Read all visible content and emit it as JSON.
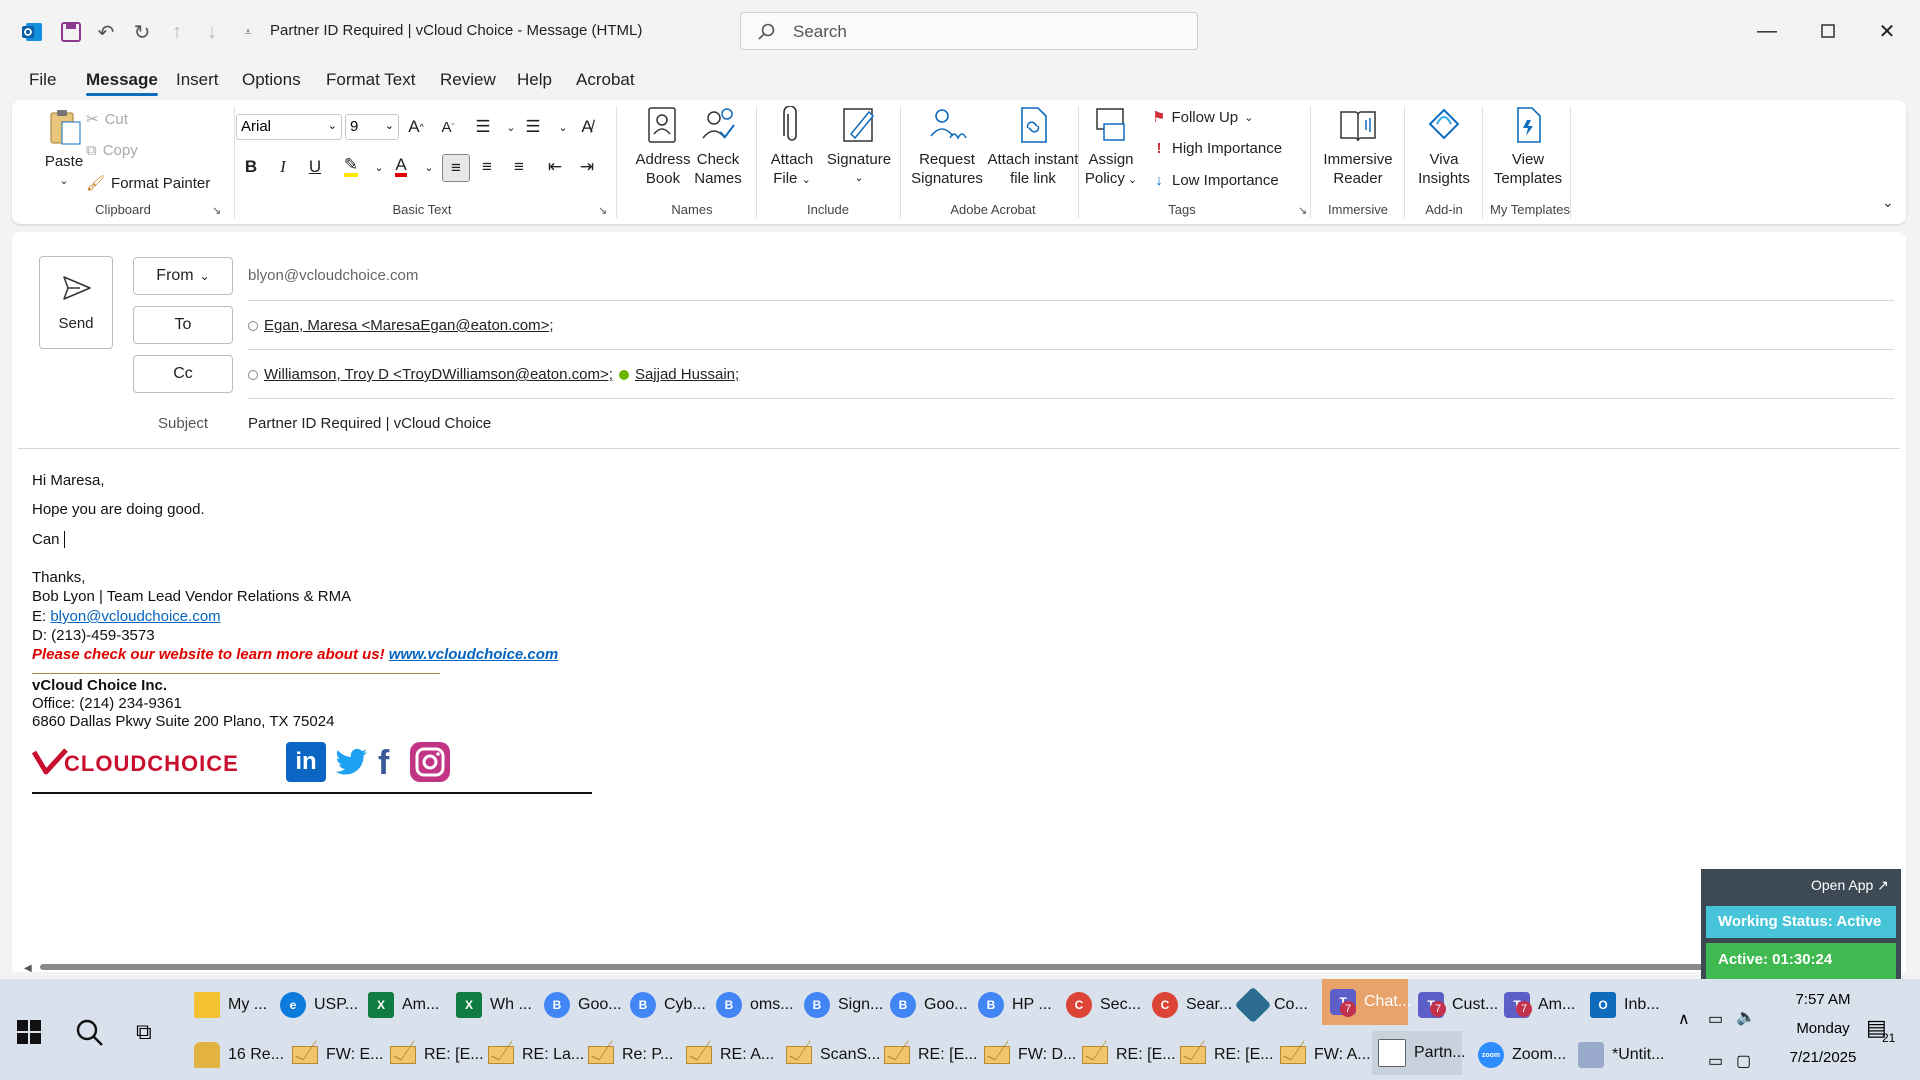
{
  "window": {
    "title": "Partner ID Required | vCloud Choice  -  Message (HTML)",
    "search_placeholder": "Search"
  },
  "menu": {
    "items": [
      "File",
      "Message",
      "Insert",
      "Options",
      "Format Text",
      "Review",
      "Help",
      "Acrobat"
    ],
    "active": "Message"
  },
  "ribbon": {
    "clipboard": {
      "paste": "Paste",
      "cut": "Cut",
      "copy": "Copy",
      "format_painter": "Format Painter",
      "group": "Clipboard"
    },
    "basic_text": {
      "font": "Arial",
      "size": "9",
      "group": "Basic Text"
    },
    "names": {
      "address_book_1": "Address",
      "address_book_2": "Book",
      "check_names_1": "Check",
      "check_names_2": "Names",
      "group": "Names"
    },
    "include": {
      "attach_1": "Attach",
      "attach_2": "File",
      "signature": "Signature",
      "group": "Include"
    },
    "adobe": {
      "request_1": "Request",
      "request_2": "Signatures",
      "attach_link_1": "Attach instant",
      "attach_link_2": "file link",
      "group": "Adobe Acrobat"
    },
    "tags": {
      "assign_1": "Assign",
      "assign_2": "Policy",
      "follow_up": "Follow Up",
      "high": "High Importance",
      "low": "Low Importance",
      "group": "Tags"
    },
    "immersive": {
      "label_1": "Immersive",
      "label_2": "Reader",
      "group": "Immersive"
    },
    "addin": {
      "label_1": "Viva",
      "label_2": "Insights",
      "group": "Add-in"
    },
    "templates": {
      "label_1": "View",
      "label_2": "Templates",
      "group": "My Templates"
    }
  },
  "compose": {
    "send": "Send",
    "from_label": "From",
    "from_value": "blyon@vcloudchoice.com",
    "to_label": "To",
    "to_value": "Egan, Maresa <MaresaEgan@eaton.com>;",
    "cc_label": "Cc",
    "cc_value_1": "Williamson, Troy D <TroyDWilliamson@eaton.com>;",
    "cc_value_2": "Sajjad Hussain;",
    "subject_label": "Subject",
    "subject_value": "Partner ID Required | vCloud Choice"
  },
  "body": {
    "greeting": "Hi Maresa,",
    "line1": "Hope you are doing good.",
    "line2": "Can ",
    "thanks": "Thanks,",
    "sig_name": "Bob Lyon | Team Lead Vendor Relations & RMA",
    "sig_email_prefix": "E: ",
    "sig_email": "blyon@vcloudchoice.com",
    "sig_phone": "D: (213)-459-3573",
    "promo": "Please check our website to learn more about us! ",
    "promo_link": "www.vcloudchoice.com",
    "company": "vCloud Choice Inc.",
    "office": "Office: (214) 234-9361",
    "address": "6860 Dallas Pkwy Suite 200 Plano, TX 75024",
    "logo": "VCLOUDCHOICE"
  },
  "widget": {
    "open_app": "Open App ↗",
    "working_status": "Working Status: Active",
    "active_timer": "Active: 01:30:24"
  },
  "taskbar": {
    "row1": [
      "My ...",
      "USP...",
      "Am...",
      "Wh ...",
      "Goo...",
      "Cyb...",
      "oms...",
      "Sign...",
      "Goo...",
      "HP ...",
      "Sec...",
      "Sear...",
      "Co...",
      "Chat...",
      "Cust...",
      "Am...",
      "Inb..."
    ],
    "row2": [
      "16 Re...",
      "FW: E...",
      "RE: [E...",
      "RE: La...",
      "Re: P...",
      "RE: A...",
      "ScanS...",
      "RE: [E...",
      "FW: D...",
      "RE: [E...",
      "RE: [E...",
      "FW: A...",
      "Partn...",
      "Zoom...",
      "*Untit..."
    ],
    "time": "7:57 AM",
    "day": "Monday",
    "date": "7/21/2025",
    "notif_count": "21",
    "teams_badge": "7"
  },
  "colors": {
    "accent": "#0f6cbd",
    "promo_red": "#e00000",
    "widget_green": "#3fb950",
    "logo_red": "#c8102e"
  }
}
